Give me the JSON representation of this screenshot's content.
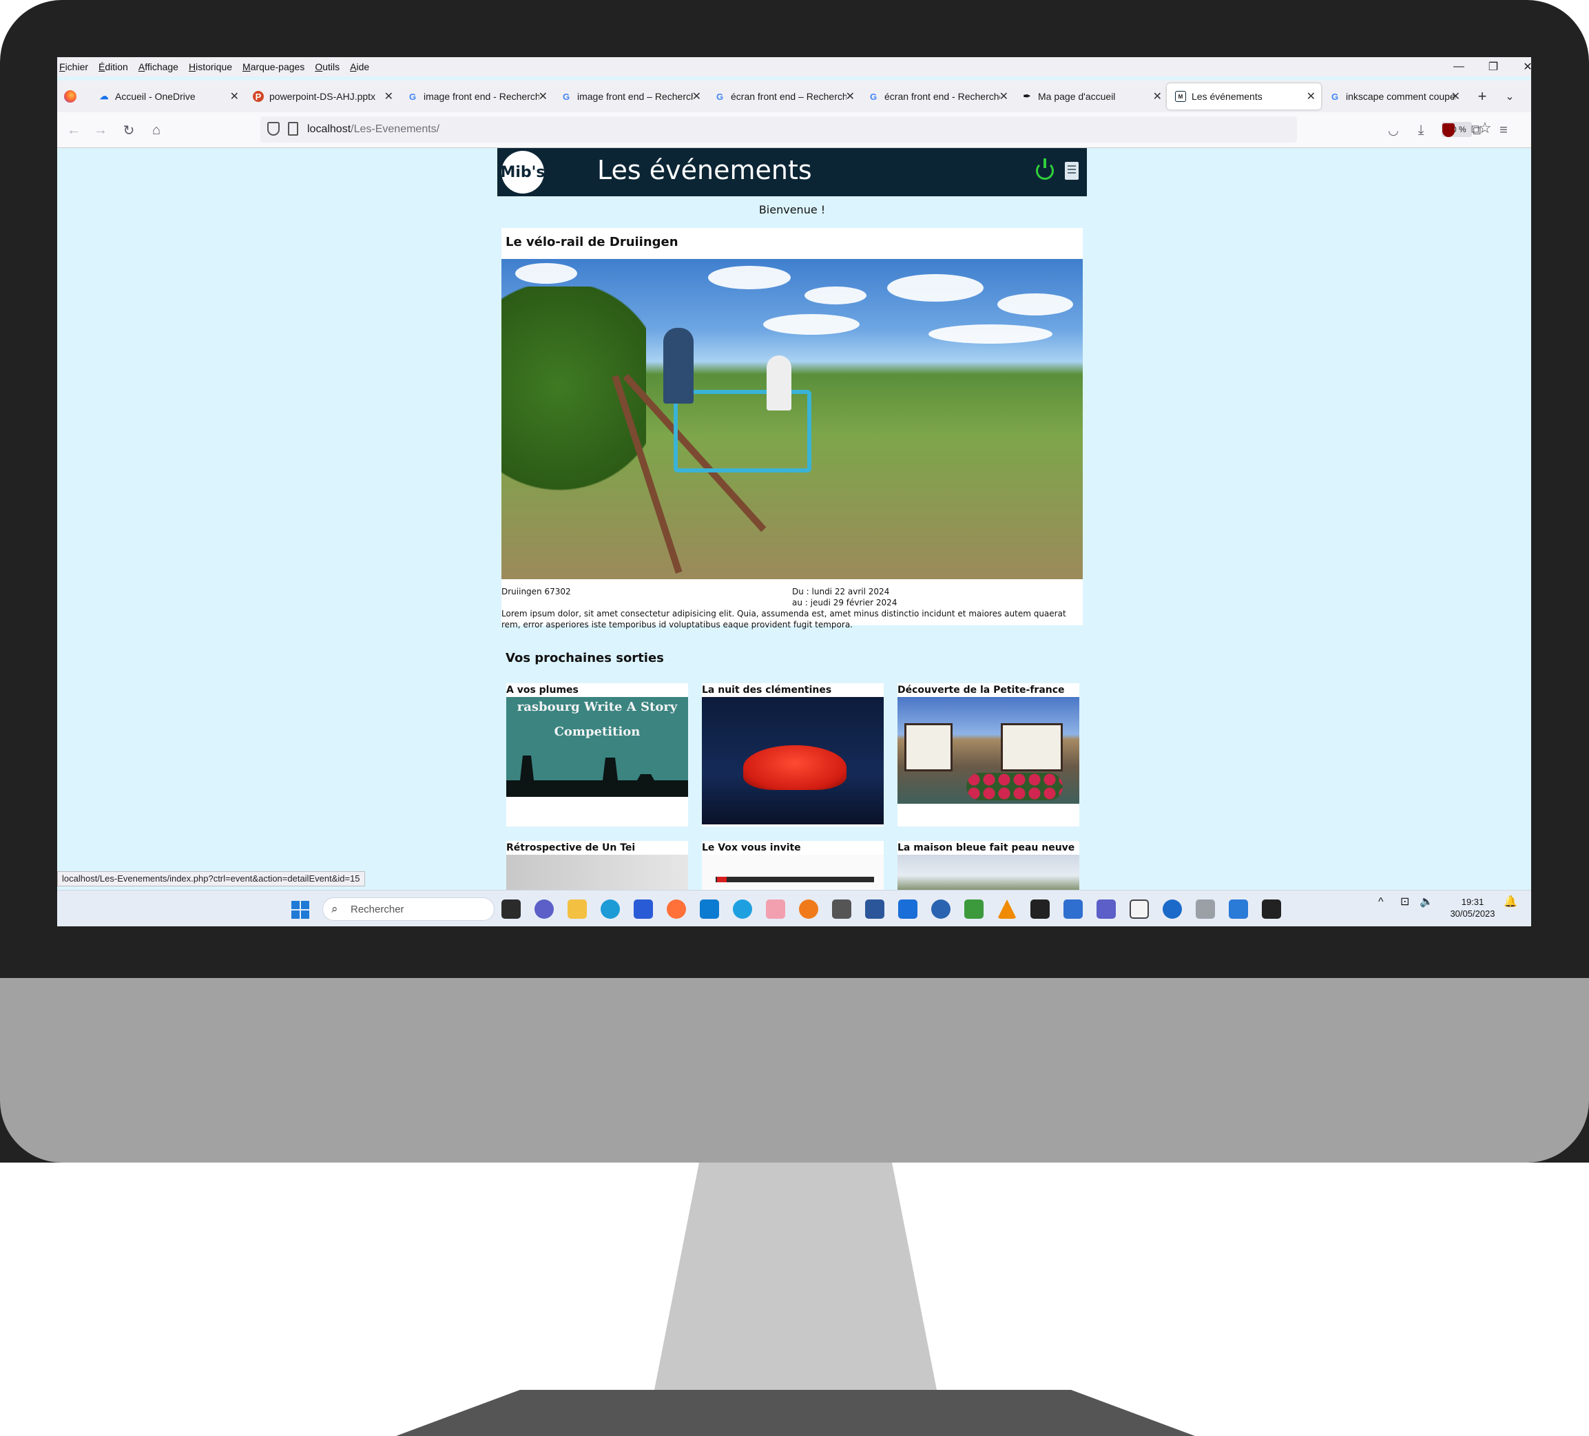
{
  "browser": {
    "menu": [
      "Fichier",
      "Édition",
      "Affichage",
      "Historique",
      "Marque-pages",
      "Outils",
      "Aide"
    ],
    "tabs": [
      {
        "label": "Accueil - OneDrive",
        "icon": "onedrive-icon"
      },
      {
        "label": "powerpoint-DS-AHJ.pptx",
        "icon": "powerpoint-icon"
      },
      {
        "label": "image front end - Recherche",
        "icon": "google-icon"
      },
      {
        "label": "image front end – Recherche",
        "icon": "google-icon"
      },
      {
        "label": "écran front end – Recherche",
        "icon": "google-icon"
      },
      {
        "label": "écran front end - Recherche",
        "icon": "google-icon"
      },
      {
        "label": "Ma page d'accueil",
        "icon": "feather-icon"
      },
      {
        "label": "Les événements",
        "icon": "mibs-icon",
        "active": true
      },
      {
        "label": "inkscape comment couper",
        "icon": "google-icon"
      }
    ],
    "url_host": "localhost",
    "url_path": "/Les-Evenements/",
    "zoom": "60 %",
    "status_url": "localhost/Les-Evenements/index.php?ctrl=event&action=detailEvent&id=15"
  },
  "site": {
    "logo_text": "Mib's",
    "title": "Les événements",
    "welcome": "Bienvenue !",
    "featured": {
      "title": "Le vélo-rail de Druiingen",
      "location": "Druiingen 67302",
      "date_from": "Du : lundi 22 avril 2024",
      "date_to": "au : jeudi 29 février 2024",
      "description": "Lorem ipsum dolor, sit amet consectetur adipisicing elit. Quia, assumenda est, amet minus distinctio incidunt et maiores autem quaerat rem, error asperiores iste temporibus id voluptatibus eaque provident fugit tempora."
    },
    "upcoming_title": "Vos prochaines sorties",
    "cards": [
      {
        "title": "A vos plumes",
        "image_text_1": "rasbourg Write A Story",
        "image_text_2": "Competition"
      },
      {
        "title": "La nuit des clémentines"
      },
      {
        "title": "Découverte de la Petite-france"
      },
      {
        "title": "Rétrospective de Un Tei"
      },
      {
        "title": "Le Vox vous invite"
      },
      {
        "title": "La maison bleue fait peau neuve"
      }
    ]
  },
  "taskbar": {
    "search_placeholder": "Rechercher",
    "time": "19:31",
    "date": "30/05/2023"
  }
}
